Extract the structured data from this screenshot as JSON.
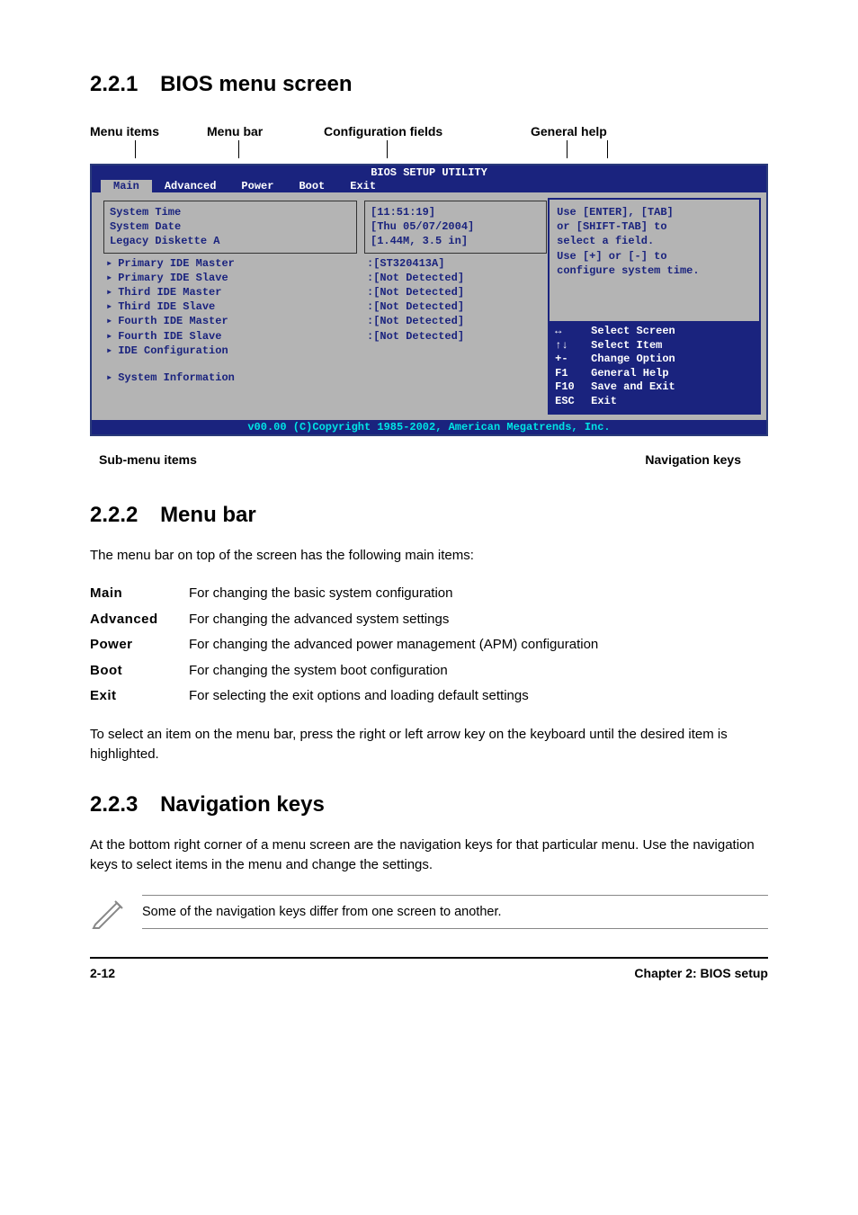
{
  "headings": {
    "h1": {
      "num": "2.2.1",
      "title": "BIOS menu screen"
    },
    "h2": {
      "num": "2.2.2",
      "title": "Menu bar"
    },
    "h3": {
      "num": "2.2.3",
      "title": "Navigation keys"
    }
  },
  "diagram_labels": {
    "top": [
      "Menu items",
      "Menu bar",
      "Configuration fields",
      "General help"
    ],
    "bottom_left": "Sub-menu items",
    "bottom_right": "Navigation keys"
  },
  "bios": {
    "title": "BIOS SETUP UTILITY",
    "tabs": [
      "Main",
      "Advanced",
      "Power",
      "Boot",
      "Exit"
    ],
    "active_tab": "Main",
    "left_items": [
      "System Time",
      "System Date",
      "Legacy Diskette A"
    ],
    "left_submenu": [
      "Primary IDE Master",
      "Primary IDE Slave",
      "Third IDE Master",
      "Third IDE Slave",
      "Fourth IDE Master",
      "Fourth IDE Slave",
      "IDE Configuration"
    ],
    "left_submenu2": [
      "System Information"
    ],
    "center_values": [
      "[11:51:19]",
      "[Thu 05/07/2004]",
      "[1.44M, 3.5 in]"
    ],
    "center_values2": [
      ":[ST320413A]",
      ":[Not Detected]",
      ":[Not Detected]",
      ":[Not Detected]",
      ":[Not Detected]",
      ":[Not Detected]"
    ],
    "help_text": [
      "Use [ENTER], [TAB]",
      "or [SHIFT-TAB] to",
      "select a field.",
      "",
      "Use [+] or [-] to",
      "configure system time."
    ],
    "nav_keys": [
      {
        "key": "↔",
        "label": "Select Screen"
      },
      {
        "key": "↑↓",
        "label": "Select Item"
      },
      {
        "key": "+-",
        "label": "Change Option"
      },
      {
        "key": "F1",
        "label": "General Help"
      },
      {
        "key": "F10",
        "label": "Save and Exit"
      },
      {
        "key": "ESC",
        "label": "Exit"
      }
    ],
    "footer": "v00.00 (C)Copyright 1985-2002, American Megatrends, Inc."
  },
  "menu_bar_intro": "The menu bar on top of the screen has the following main items:",
  "menu_items": [
    {
      "name": "Main",
      "desc": "For changing the basic system configuration"
    },
    {
      "name": "Advanced",
      "desc": "For changing the advanced system settings"
    },
    {
      "name": "Power",
      "desc": "For changing the advanced power management (APM) configuration"
    },
    {
      "name": "Boot",
      "desc": "For changing the system boot configuration"
    },
    {
      "name": "Exit",
      "desc": "For selecting the exit options and loading default settings"
    }
  ],
  "menu_bar_outro": "To select an item on the menu bar, press the right or left arrow key on the keyboard until the desired item is highlighted.",
  "nav_keys_body": "At the bottom right corner of a menu screen are the navigation keys for that particular menu. Use the navigation keys to select items in the menu and change the settings.",
  "note": "Some of the navigation keys differ from one screen to another.",
  "footer": {
    "left": "2-12",
    "right": "Chapter 2: BIOS setup"
  }
}
